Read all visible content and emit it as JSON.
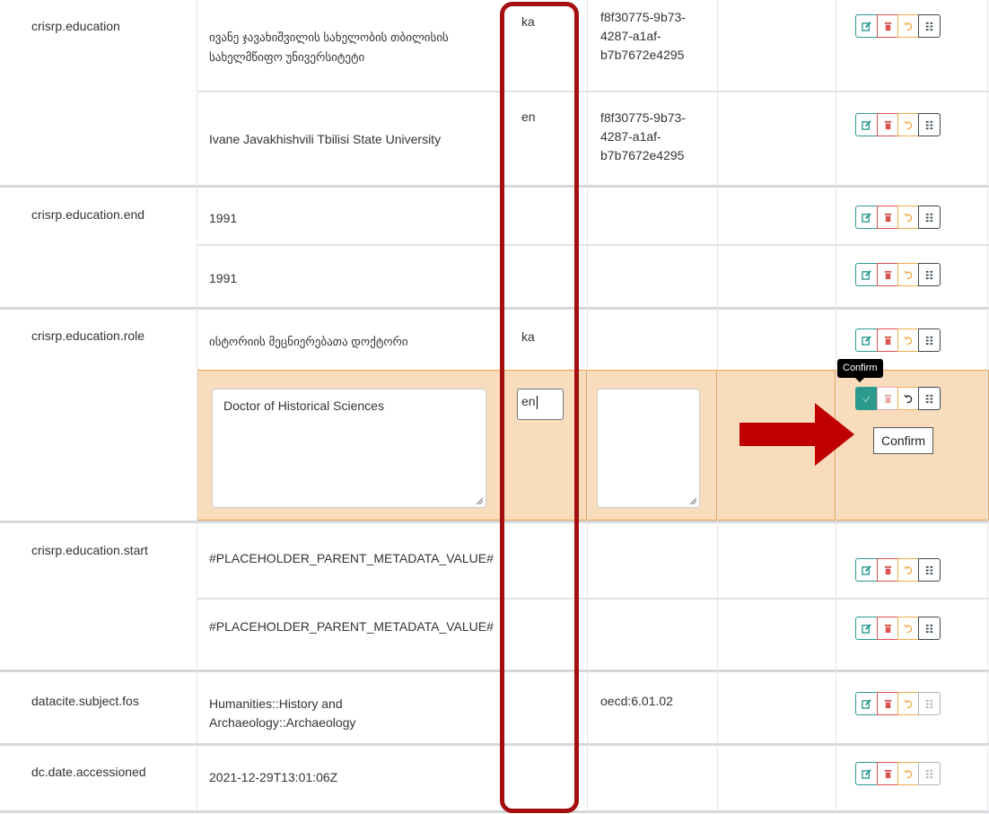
{
  "colors": {
    "accent": "#2a9a8c",
    "danger": "#d9534f",
    "warning": "#f0ad4e",
    "edit_highlight": "#f8dcbc",
    "annotation": "#a50e0e"
  },
  "rows": [
    {
      "field": "crisrp.education",
      "value": "ივანე ჯავახიშვილის სახელობის თბილისის სახელმწიფო უნივერსიტეტი",
      "language": "ka",
      "authority": "f8f30775-9b73-4287-a1af-b7b7672e4295"
    },
    {
      "field": "",
      "value": "Ivane Javakhishvili Tbilisi State University",
      "language": "en",
      "authority": "f8f30775-9b73-4287-a1af-b7b7672e4295"
    },
    {
      "field": "crisrp.education.end",
      "value": "1991",
      "language": "",
      "authority": ""
    },
    {
      "field": "",
      "value": "1991",
      "language": "",
      "authority": ""
    },
    {
      "field": "crisrp.education.role",
      "value": "ისტორიის მეცნიერებათა დოქტორი",
      "language": "ka",
      "authority": ""
    },
    {
      "field": "",
      "value": "Doctor of Historical Sciences",
      "language": "en",
      "authority": "",
      "editing": true
    },
    {
      "field": "crisrp.education.start",
      "value": "#PLACEHOLDER_PARENT_METADATA_VALUE#",
      "language": "",
      "authority": ""
    },
    {
      "field": "",
      "value": "#PLACEHOLDER_PARENT_METADATA_VALUE#",
      "language": "",
      "authority": ""
    },
    {
      "field": "datacite.subject.fos",
      "value": "Humanities::History and Archaeology::Archaeology",
      "language": "",
      "authority": "oecd:6.01.02"
    },
    {
      "field": "dc.date.accessioned",
      "value": "2021-12-29T13:01:06Z",
      "language": "",
      "authority": ""
    }
  ],
  "tooltip": {
    "label": "Confirm"
  },
  "icons": {
    "edit": "edit-icon",
    "delete": "trash-icon",
    "undo": "undo-icon",
    "drag": "drag-handle-icon",
    "confirm": "check-icon"
  }
}
